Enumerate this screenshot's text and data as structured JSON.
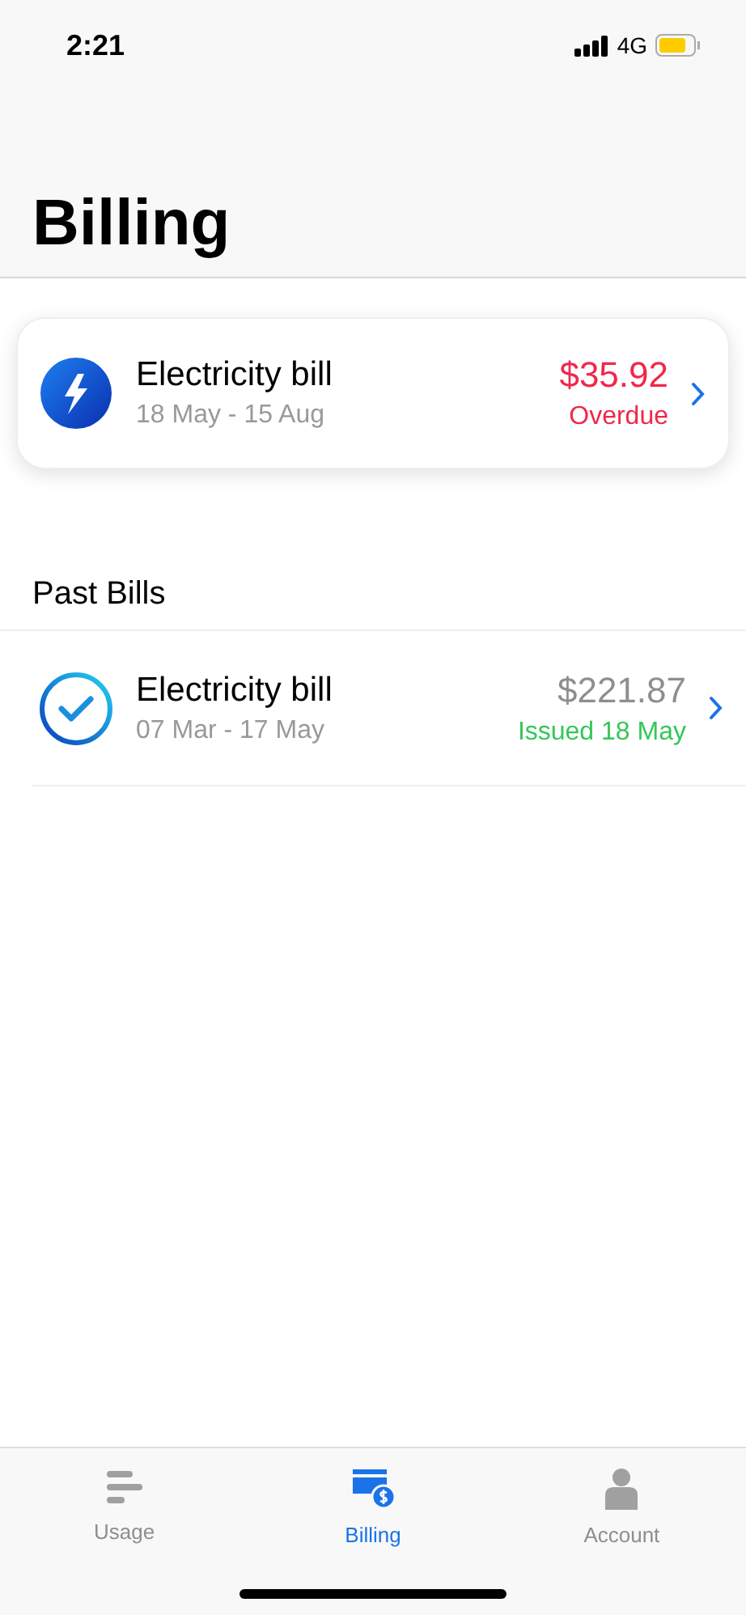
{
  "status_bar": {
    "time": "2:21",
    "network": "4G"
  },
  "header": {
    "title": "Billing"
  },
  "current_bill": {
    "kind": "overdue",
    "name": "Electricity bill",
    "period": "18 May - 15 Aug",
    "amount": "$35.92",
    "status": "Overdue"
  },
  "past_bills": {
    "title": "Past Bills",
    "items": [
      {
        "kind": "paid",
        "name": "Electricity bill",
        "period": "07 Mar - 17 May",
        "amount": "$221.87",
        "status": "Issued 18 May"
      }
    ]
  },
  "tab_bar": [
    {
      "kind": "usage",
      "label": "Usage",
      "selected": false
    },
    {
      "kind": "billing",
      "label": "Billing",
      "selected": true
    },
    {
      "kind": "account",
      "label": "Account",
      "selected": false
    }
  ]
}
